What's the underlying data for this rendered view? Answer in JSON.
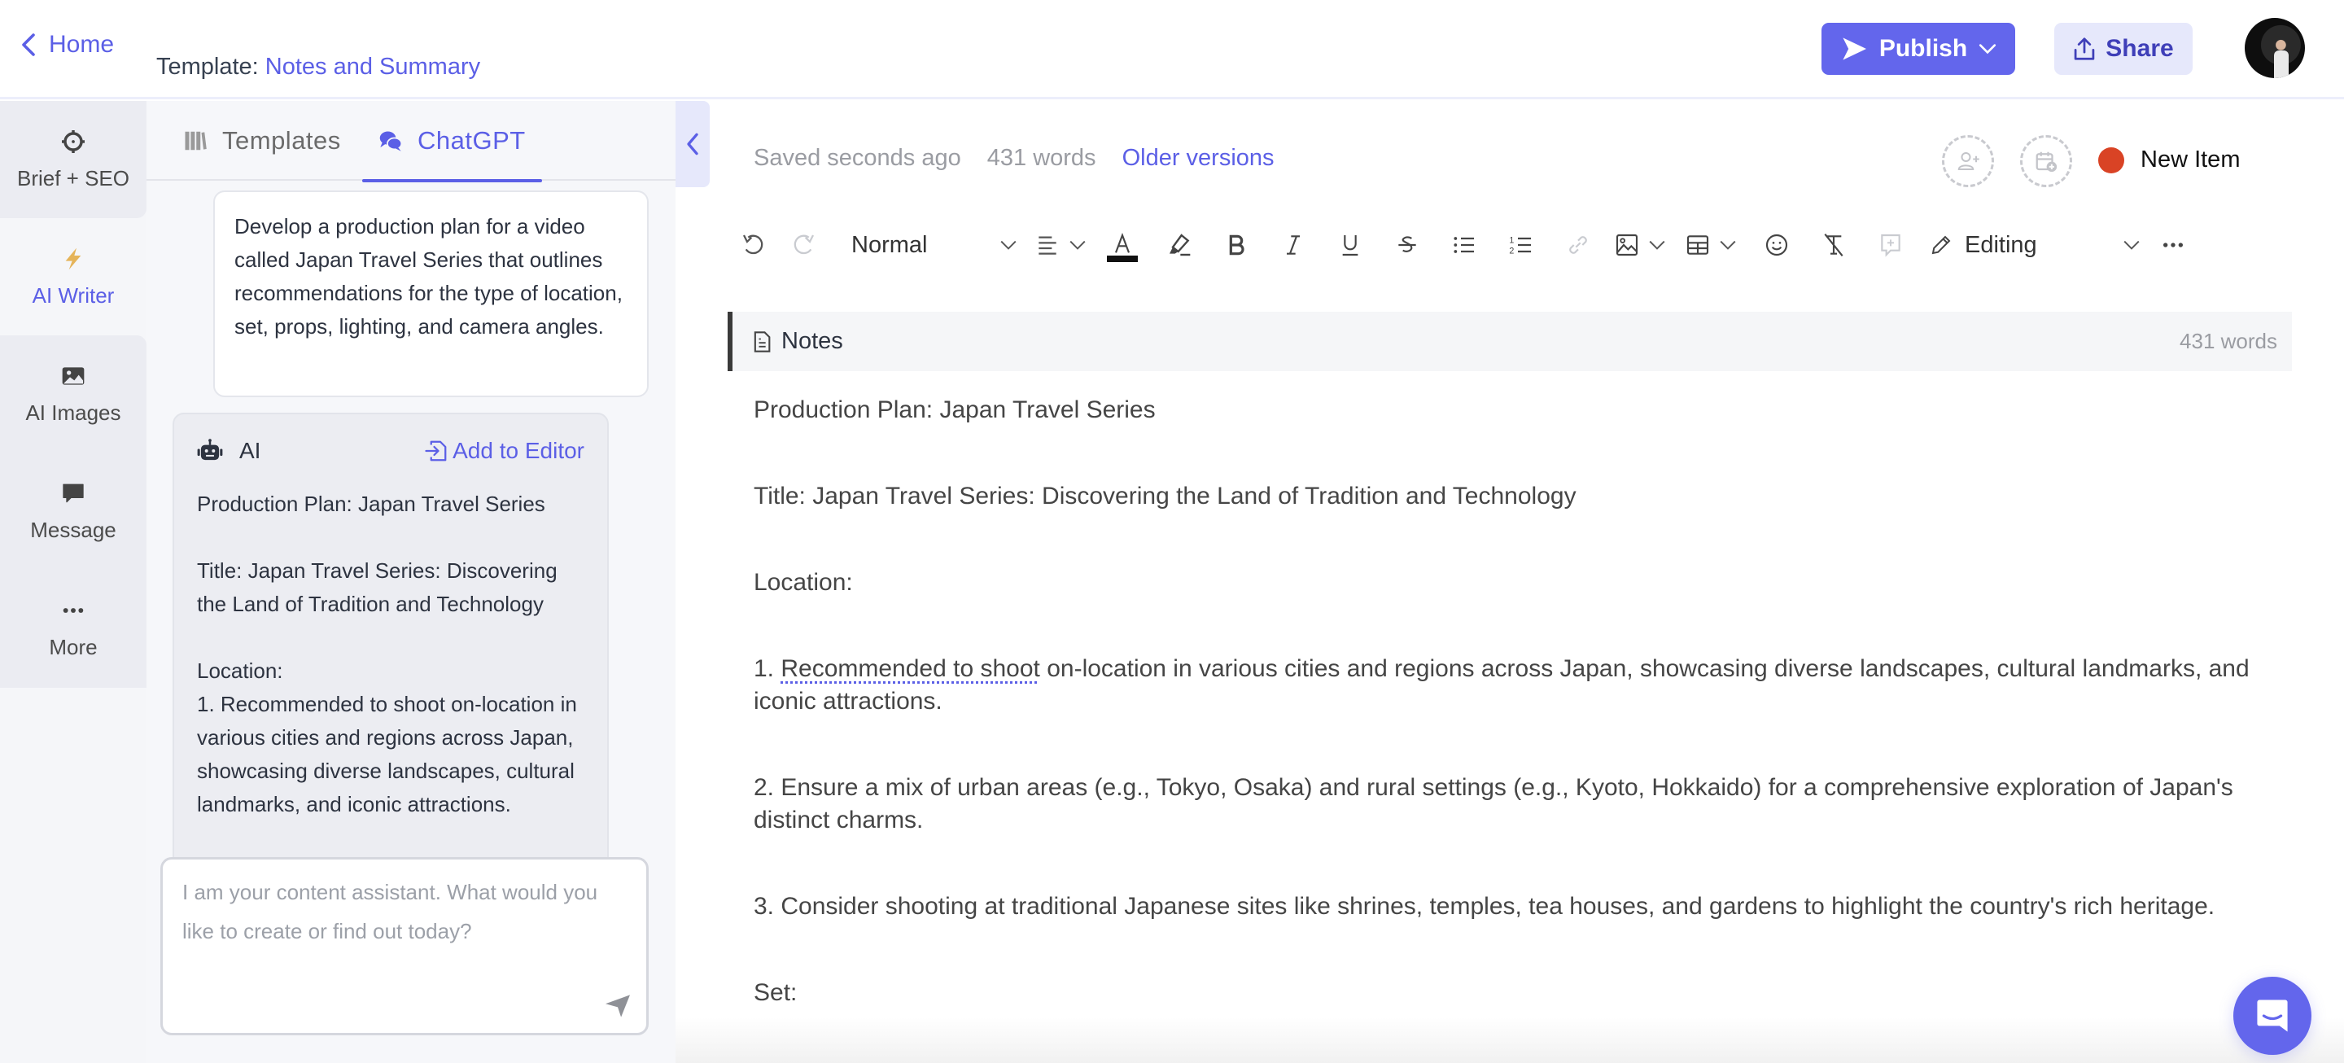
{
  "header": {
    "home_label": "Home",
    "template_prefix": "Template:",
    "template_name": "Notes and Summary",
    "publish_label": "Publish",
    "share_label": "Share"
  },
  "leftnav": {
    "items": [
      {
        "label": "Brief + SEO",
        "icon": "crosshair-icon",
        "active": false
      },
      {
        "label": "AI Writer",
        "icon": "lightning-icon",
        "active": true
      },
      {
        "label": "AI Images",
        "icon": "image-icon",
        "active": false
      },
      {
        "label": "Message",
        "icon": "chat-bubble-icon",
        "active": false
      },
      {
        "label": "More",
        "icon": "more-dots-icon",
        "active": false
      }
    ]
  },
  "panel": {
    "tabs": [
      {
        "label": "Templates",
        "icon": "books-icon",
        "active": false
      },
      {
        "label": "ChatGPT",
        "icon": "chat-bubbles-icon",
        "active": true
      }
    ],
    "prompt": "Develop a production plan for a video called Japan Travel Series that outlines recommendations for the type of location, set, props, lighting, and camera angles.",
    "ai_response": {
      "sender": "AI",
      "add_to_editor_label": "Add to Editor",
      "paragraphs": [
        "Production Plan: Japan Travel Series",
        "Title: Japan Travel Series: Discovering the Land of Tradition and Technology",
        "Location:",
        "1. Recommended to shoot on-location in various cities and regions across Japan, showcasing diverse landscapes, cultural landmarks, and iconic attractions."
      ]
    },
    "input_placeholder": "I am your content assistant. What would you like to create or find out today?"
  },
  "editor": {
    "saved_status": "Saved seconds ago",
    "word_count": "431 words",
    "older_versions_label": "Older versions",
    "item_status": {
      "label": "New Item",
      "color": "#d94325"
    },
    "toolbar": {
      "block_style": "Normal",
      "mode": "Editing"
    },
    "section": {
      "title": "Notes",
      "word_count": "431 words"
    },
    "content": {
      "heading": "Production Plan: Japan Travel Series",
      "title_line": "Title: Japan Travel Series: Discovering the Land of Tradition and Technology",
      "location_label": "Location:",
      "item1_flagged": "Recommended to shoot",
      "item1_prefix": "1. ",
      "item1_rest": " on-location in various cities and regions across Japan, showcasing diverse landscapes, cultural landmarks, and iconic attractions.",
      "item2": "2. Ensure a mix of urban areas (e.g., Tokyo, Osaka) and rural settings (e.g., Kyoto, Hokkaido) for a comprehensive exploration of Japan's distinct charms.",
      "item3": "3. Consider shooting at traditional Japanese sites like shrines, temples, tea houses, and gardens to highlight the country's rich heritage.",
      "set_label": "Set:"
    }
  },
  "colors": {
    "accent": "#5b5fe6",
    "publish_bg": "#6366ec",
    "share_bg": "#e6e8fb",
    "status_dot": "#d94325"
  }
}
